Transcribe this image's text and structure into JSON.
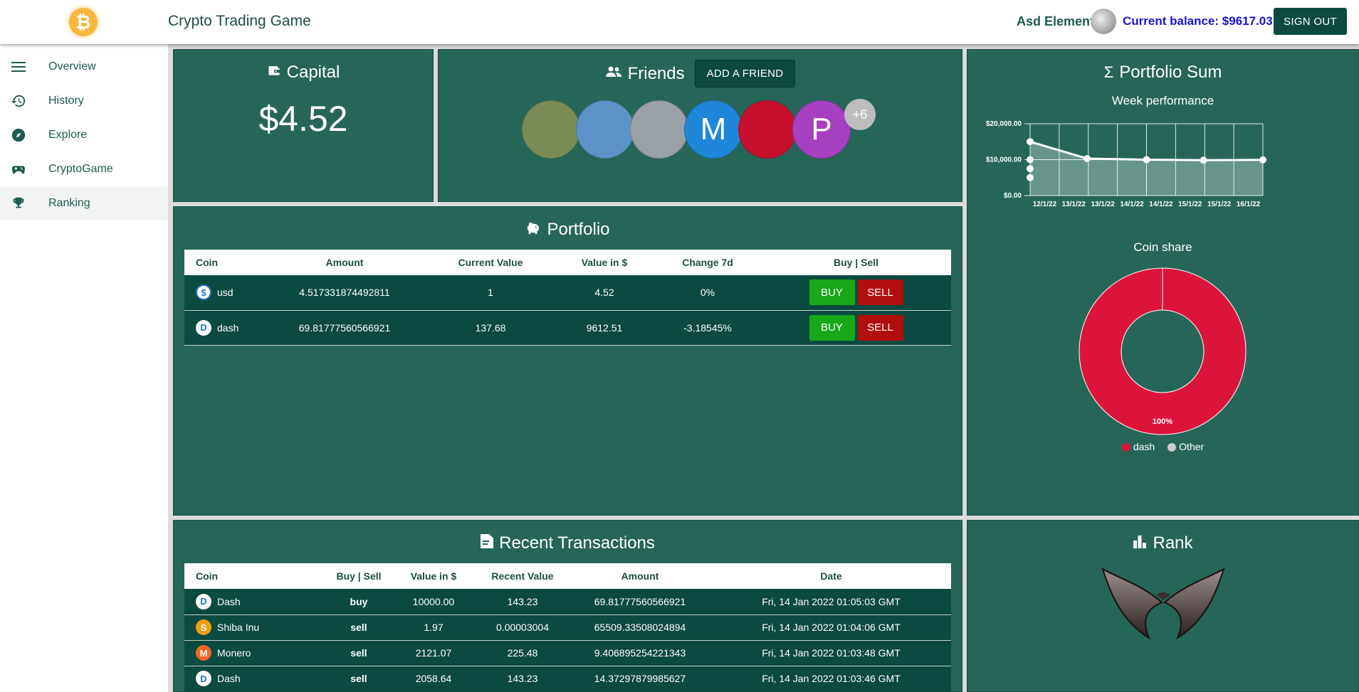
{
  "header": {
    "app_title": "Crypto Trading Game",
    "logo_symbol": "₿",
    "user_name": "Asd Element",
    "balance": "Current balance: $9617.03",
    "signout_label": "SIGN OUT"
  },
  "sidebar": {
    "items": [
      {
        "label": "Overview",
        "icon": "menu-icon"
      },
      {
        "label": "History",
        "icon": "history-icon"
      },
      {
        "label": "Explore",
        "icon": "compass-icon"
      },
      {
        "label": "CryptoGame",
        "icon": "gamepad-icon"
      },
      {
        "label": "Ranking",
        "icon": "trophy-icon",
        "active": true
      }
    ]
  },
  "capital": {
    "title": "Capital",
    "value": "$4.52"
  },
  "friends": {
    "title": "Friends",
    "add_label": "ADD A FRIEND",
    "avatars": [
      {
        "letter": "",
        "color": "#7a8c55"
      },
      {
        "letter": "",
        "color": "#5b93c9"
      },
      {
        "letter": "",
        "color": "#9aa1a6"
      },
      {
        "letter": "M",
        "color": "#1f86d9"
      },
      {
        "letter": "",
        "color": "#c8102e"
      },
      {
        "letter": "P",
        "color": "#a63fc0"
      }
    ],
    "more": "+6"
  },
  "portfolio": {
    "title": "Portfolio",
    "headers": [
      "Coin",
      "Amount",
      "Current Value",
      "Value in $",
      "Change 7d",
      "Buy | Sell"
    ],
    "buy_label": "BUY",
    "sell_label": "SELL",
    "rows": [
      {
        "coin": "usd",
        "amount": "4.517331874492811",
        "current": "1",
        "value": "4.52",
        "change": "0%"
      },
      {
        "coin": "dash",
        "amount": "69.81777560566921",
        "current": "137.68",
        "value": "9612.51",
        "change": "-3.18545%"
      }
    ]
  },
  "portfolio_sum": {
    "title": "Portfolio Sum",
    "week_title": "Week performance",
    "share_title": "Coin share"
  },
  "chart_data": [
    {
      "type": "area",
      "title": "Week performance",
      "x": [
        "12/1/22",
        "12/1/22",
        "12/1/22",
        "12/1/22",
        "13/1/22",
        "13/1/22",
        "14/1/22",
        "14/1/22",
        "15/1/22",
        "15/1/22",
        "16/1/22"
      ],
      "xlabels": [
        "12/1/22",
        "13/1/22",
        "13/1/22",
        "14/1/22",
        "14/1/22",
        "15/1/22",
        "15/1/22",
        "16/1/22"
      ],
      "series": [
        {
          "values": [
            5000,
            7500,
            10000,
            15000,
            10300,
            10050,
            10000,
            9900,
            9850,
            9900,
            9950
          ]
        }
      ],
      "ylim": [
        0,
        20000
      ],
      "yticks": [
        "$0.00",
        "$10,000.00",
        "$20,000.00"
      ],
      "grid": true
    },
    {
      "type": "pie",
      "title": "Coin share",
      "slices": [
        {
          "label": "dash",
          "value": 100,
          "color": "#dc143c"
        },
        {
          "label": "Other",
          "value": 0,
          "color": "#cccccc"
        }
      ],
      "center_label": "100%"
    }
  ],
  "transactions": {
    "title": "Recent Transactions",
    "headers": [
      "Coin",
      "Buy | Sell",
      "Value in $",
      "Recent Value",
      "Amount",
      "Date"
    ],
    "rows": [
      {
        "coin": "Dash",
        "type": "buy",
        "value": "10000.00",
        "recent": "143.23",
        "amount": "69.81777560566921",
        "date": "Fri, 14 Jan 2022 01:05:03 GMT",
        "icon_bg": "#1c75bc",
        "icon_text": "D"
      },
      {
        "coin": "Shiba Inu",
        "type": "sell",
        "value": "1.97",
        "recent": "0.00003004",
        "amount": "65509.33508024894",
        "date": "Fri, 14 Jan 2022 01:04:06 GMT",
        "icon_bg": "#f39c12",
        "icon_text": "S"
      },
      {
        "coin": "Monero",
        "type": "sell",
        "value": "2121.07",
        "recent": "225.48",
        "amount": "9.406895254221343",
        "date": "Fri, 14 Jan 2022 01:03:48 GMT",
        "icon_bg": "#f26822",
        "icon_text": "M"
      },
      {
        "coin": "Dash",
        "type": "sell",
        "value": "2058.64",
        "recent": "143.23",
        "amount": "14.37297879985627",
        "date": "Fri, 14 Jan 2022 01:03:46 GMT",
        "icon_bg": "#1c75bc",
        "icon_text": "D"
      }
    ]
  },
  "rank": {
    "title": "Rank",
    "emblem": "rank-emblem-icon"
  },
  "colors": {
    "panel": "#266659",
    "row": "#0b4a40",
    "accent": "#0c4a40",
    "buy": "#18a818",
    "sell": "#b00d0d",
    "balance": "#1414d6"
  }
}
